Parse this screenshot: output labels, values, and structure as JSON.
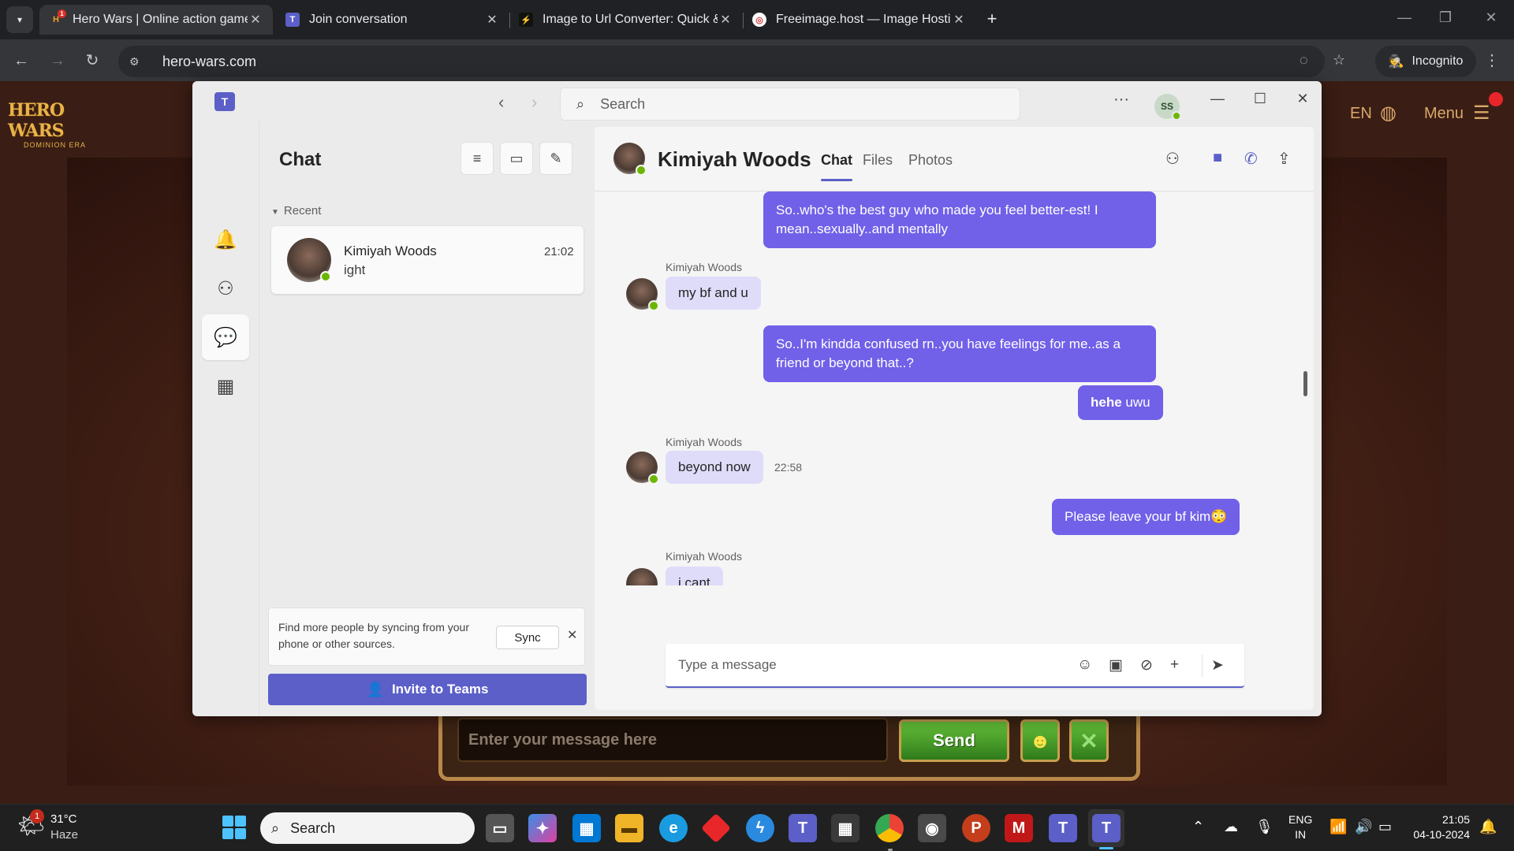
{
  "browser": {
    "tabs": [
      {
        "title": "Hero Wars | Online action game",
        "favicon": "H",
        "badge": "1"
      },
      {
        "title": "Join conversation",
        "favicon": "T"
      },
      {
        "title": "Image to Url Converter: Quick &",
        "favicon": "⚡"
      },
      {
        "title": "Freeimage.host — Image Hosting",
        "favicon": "◎"
      }
    ],
    "url": "hero-wars.com",
    "incognito_label": "Incognito"
  },
  "game": {
    "logo_main": "HERO WARS",
    "logo_sub": "DOMINION ERA",
    "lang": "EN",
    "menu_label": "Menu",
    "chat_placeholder": "Enter your message here",
    "send_label": "Send"
  },
  "teams": {
    "search_placeholder": "Search",
    "account_initials": "SS",
    "chat_title": "Chat",
    "recent_label": "Recent",
    "conversation": {
      "name": "Kimiyah Woods",
      "preview": "ight",
      "time": "21:02"
    },
    "sync_message": "Find more people by syncing from your phone or other sources.",
    "sync_button": "Sync",
    "invite_button": "Invite to Teams",
    "header": {
      "name": "Kimiyah Woods",
      "tabs": [
        "Chat",
        "Files",
        "Photos"
      ]
    },
    "messages": {
      "m1": "So..who's the best guy who made you feel better-est! I mean..sexually..and mentally",
      "s1": "Kimiyah Woods",
      "m2": "my bf and u",
      "m3": "So..I'm kindda confused rn..you have feelings for me..as a friend or beyond that..?",
      "m4_bold": "hehe",
      "m4_rest": " uwu",
      "s2": "Kimiyah Woods",
      "m5": "beyond now",
      "m5_time": "22:58",
      "m6": "Please leave your bf kim😳",
      "s3": "Kimiyah Woods",
      "m7": "i cant"
    },
    "compose_placeholder": "Type a message"
  },
  "taskbar": {
    "weather_temp": "31°C",
    "weather_cond": "Haze",
    "weather_badge": "1",
    "search_label": "Search",
    "lang_top": "ENG",
    "lang_bottom": "IN",
    "time": "21:05",
    "date": "04-10-2024"
  },
  "colors": {
    "teams_accent": "#5b5fc7",
    "bubble_me": "#7160e8",
    "bubble_them": "#dedcf9",
    "presence": "#6bb700"
  }
}
